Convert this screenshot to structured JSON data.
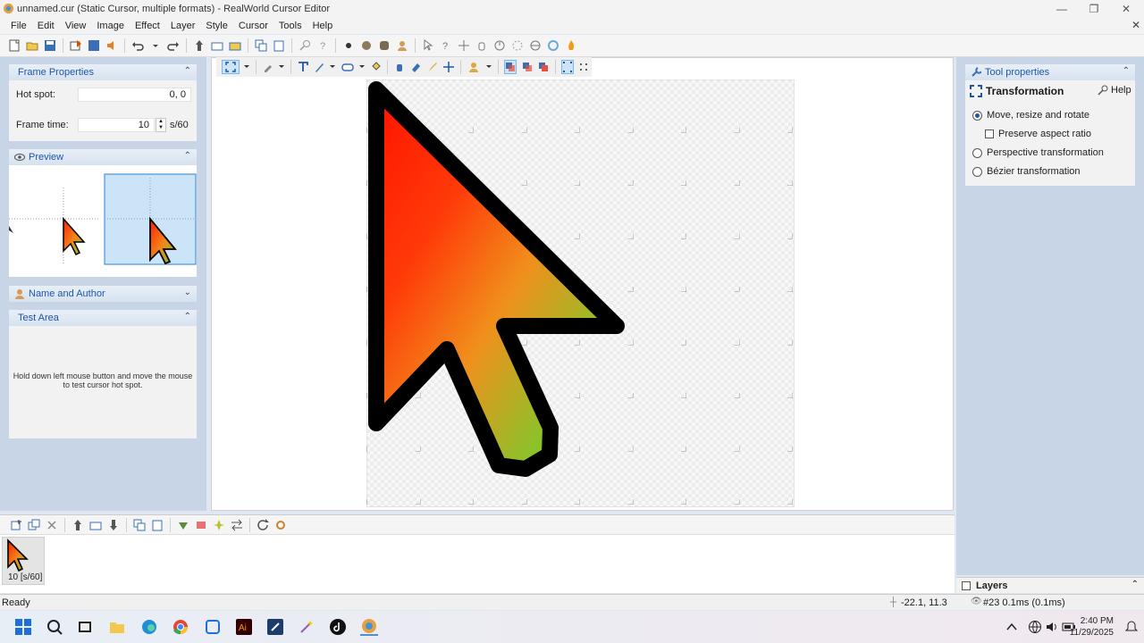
{
  "window": {
    "title": "unnamed.cur (Static Cursor, multiple formats) - RealWorld Cursor Editor",
    "minimize": "—",
    "maximize": "❐",
    "close": "✕"
  },
  "menu": [
    "File",
    "Edit",
    "View",
    "Image",
    "Effect",
    "Layer",
    "Style",
    "Cursor",
    "Tools",
    "Help"
  ],
  "menu_close": "✕",
  "frame_properties": {
    "header": "Frame Properties",
    "hot_spot_label": "Hot spot:",
    "hot_spot_value": "0, 0",
    "frame_time_label": "Frame time:",
    "frame_time_value": "10",
    "frame_time_unit": "s/60"
  },
  "preview": {
    "header": "Preview"
  },
  "name_author": {
    "header": "Name and Author"
  },
  "test_area": {
    "header": "Test Area",
    "hint": "Hold down left mouse button and move the mouse to test cursor hot spot."
  },
  "tool_properties": {
    "header": "Tool properties",
    "tool_name": "Transformation",
    "help_label": "Help",
    "options": [
      {
        "label": "Move, resize and rotate",
        "selected": true
      },
      {
        "label": "Preserve aspect ratio",
        "checkbox": true,
        "checked": false
      },
      {
        "label": "Perspective transformation",
        "selected": false
      },
      {
        "label": "Bézier transformation",
        "selected": false
      }
    ]
  },
  "layers": {
    "header": "Layers"
  },
  "frame_strip": {
    "frame_label": "10 [s/60]"
  },
  "status": {
    "ready": "Ready",
    "coords": "-22.1, 11.3",
    "layer_info": "#23 0.1ms (0.1ms)"
  },
  "clock": {
    "time": "2:40 PM",
    "date": "11/29/2025"
  },
  "colors": {
    "panel_bg": "#c8d5e6",
    "header_text": "#1d56a8",
    "selected_frame": "#cce4f7"
  }
}
